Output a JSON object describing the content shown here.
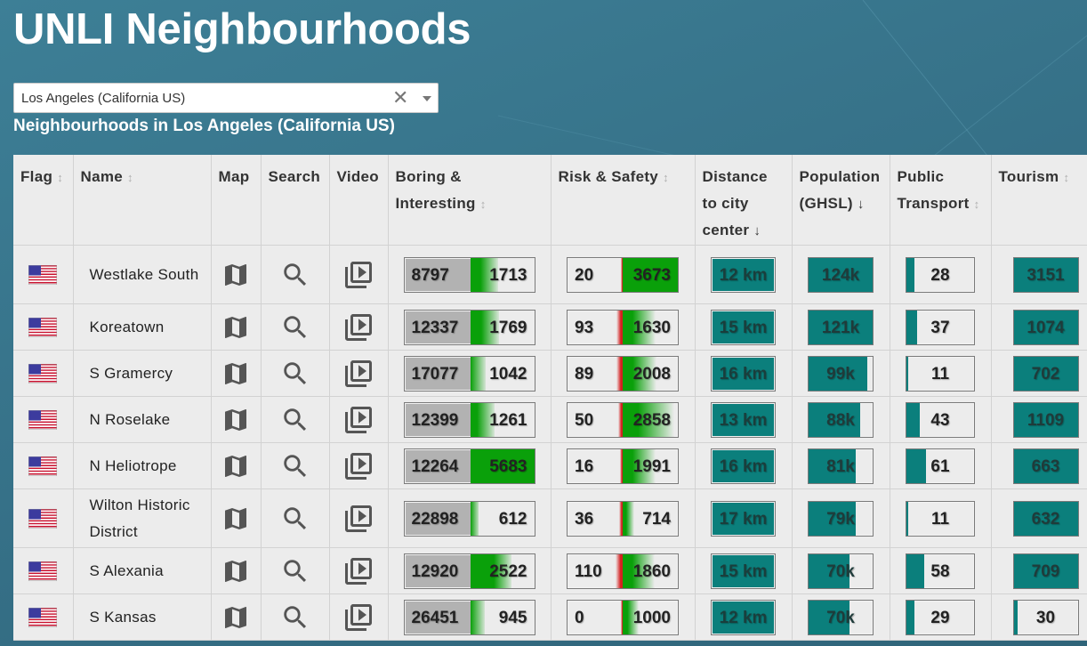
{
  "page": {
    "title": "UNLI Neighbourhoods",
    "city_select_value": "Los Angeles (California US)",
    "clear_symbol": "✕",
    "subtitle": "Neighbourhoods in Los Angeles (California US)"
  },
  "colors": {
    "background": "#3a7890",
    "table_bg": "#ececec",
    "teal": "#0b7f7c",
    "green": "#0aa00a",
    "red": "#d42020",
    "grey_bar": "#b2b2b2"
  },
  "icons": {
    "flag": "us-flag-icon",
    "map": "map-icon",
    "search": "search-icon",
    "video": "video-library-icon",
    "sort": "sort-icon"
  },
  "columns": [
    {
      "label": "Flag",
      "sort": "↕"
    },
    {
      "label": "Name",
      "sort": "↕"
    },
    {
      "label": "Map",
      "sort": ""
    },
    {
      "label": "Search",
      "sort": ""
    },
    {
      "label": "Video",
      "sort": ""
    },
    {
      "label": "Boring & Interesting",
      "sort": "↕"
    },
    {
      "label": "Risk & Safety",
      "sort": "↕"
    },
    {
      "label": "Distance to city center",
      "sort": "↓"
    },
    {
      "label": "Population (GHSL)",
      "sort": "↓"
    },
    {
      "label": "Public Transport",
      "sort": "↕"
    },
    {
      "label": "Tourism",
      "sort": "↕"
    }
  ],
  "rows": [
    {
      "name": "Westlake South",
      "boring": "8797",
      "interesting": "1713",
      "interesting_share": 0.45,
      "risk": "20",
      "risk_share": 0.0,
      "safety": "3673",
      "safety_share": 1.0,
      "distance": "12 km",
      "population": "124k",
      "population_share": 1.0,
      "transport": "28",
      "transport_share": 0.12,
      "tourism": "3151",
      "tourism_share": 1.0
    },
    {
      "name": "Koreatown",
      "boring": "12337",
      "interesting": "1769",
      "interesting_share": 0.46,
      "risk": "93",
      "risk_share": 0.08,
      "safety": "1630",
      "safety_share": 0.58,
      "distance": "15 km",
      "population": "121k",
      "population_share": 1.0,
      "transport": "37",
      "transport_share": 0.16,
      "tourism": "1074",
      "tourism_share": 1.0
    },
    {
      "name": "S Gramercy",
      "boring": "17077",
      "interesting": "1042",
      "interesting_share": 0.27,
      "risk": "89",
      "risk_share": 0.08,
      "safety": "2008",
      "safety_share": 0.6,
      "distance": "16 km",
      "population": "99k",
      "population_share": 0.89,
      "transport": "11",
      "transport_share": 0.03,
      "tourism": "702",
      "tourism_share": 1.0
    },
    {
      "name": "N Roselake",
      "boring": "12399",
      "interesting": "1261",
      "interesting_share": 0.4,
      "risk": "50",
      "risk_share": 0.05,
      "safety": "2858",
      "safety_share": 0.9,
      "distance": "13 km",
      "population": "88k",
      "population_share": 0.79,
      "transport": "43",
      "transport_share": 0.19,
      "tourism": "1109",
      "tourism_share": 1.0
    },
    {
      "name": "N Heliotrope",
      "boring": "12264",
      "interesting": "5683",
      "interesting_share": 1.0,
      "risk": "16",
      "risk_share": 0.02,
      "safety": "1991",
      "safety_share": 0.58,
      "distance": "16 km",
      "population": "81k",
      "population_share": 0.72,
      "transport": "61",
      "transport_share": 0.28,
      "tourism": "663",
      "tourism_share": 1.0
    },
    {
      "name": "Wilton Historic District",
      "boring": "22898",
      "interesting": "612",
      "interesting_share": 0.16,
      "risk": "36",
      "risk_share": 0.03,
      "safety": "714",
      "safety_share": 0.2,
      "distance": "17 km",
      "population": "79k",
      "population_share": 0.71,
      "transport": "11",
      "transport_share": 0.03,
      "tourism": "632",
      "tourism_share": 1.0
    },
    {
      "name": "S Alexania",
      "boring": "12920",
      "interesting": "2522",
      "interesting_share": 0.66,
      "risk": "110",
      "risk_share": 0.1,
      "safety": "1860",
      "safety_share": 0.56,
      "distance": "15 km",
      "population": "70k",
      "population_share": 0.62,
      "transport": "58",
      "transport_share": 0.26,
      "tourism": "709",
      "tourism_share": 1.0
    },
    {
      "name": "S Kansas",
      "boring": "26451",
      "interesting": "945",
      "interesting_share": 0.25,
      "risk": "0",
      "risk_share": 0.0,
      "safety": "1000",
      "safety_share": 0.28,
      "distance": "12 km",
      "population": "70k",
      "population_share": 0.62,
      "transport": "29",
      "transport_share": 0.12,
      "tourism": "30",
      "tourism_share": 0.06
    }
  ]
}
